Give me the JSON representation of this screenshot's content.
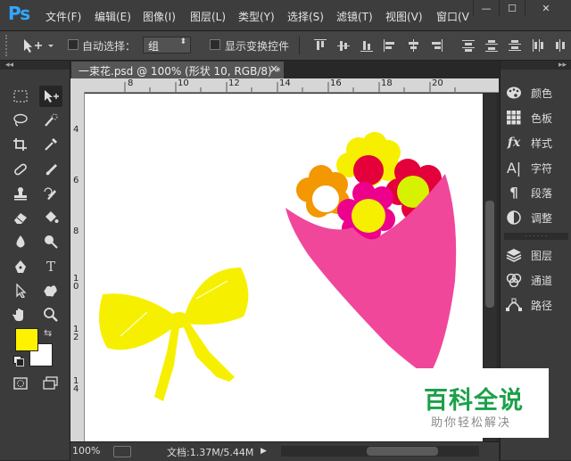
{
  "app": {
    "logo": "Ps"
  },
  "menu": [
    "文件(F)",
    "编辑(E)",
    "图像(I)",
    "图层(L)",
    "类型(Y)",
    "选择(S)",
    "滤镜(T)",
    "视图(V)",
    "窗口(V"
  ],
  "window_controls": {
    "minimize": "—",
    "maximize": "☐",
    "close": "✕"
  },
  "options": {
    "auto_select_label": "自动选择：",
    "auto_select_value": "组",
    "show_transform_label": "显示变换控件"
  },
  "document": {
    "tab_title": "一束花.psd @ 100% (形状 10, RGB/8) *",
    "close_glyph": "×"
  },
  "ruler": {
    "h_ticks": [
      "8",
      "10",
      "12",
      "14",
      "16",
      "18",
      "20"
    ],
    "v_ticks": [
      "4",
      "6",
      "8",
      "1 0",
      "1 2",
      "1 4"
    ]
  },
  "status": {
    "zoom": "100%",
    "doc_info": "文档:1.37M/5.44M"
  },
  "colors": {
    "foreground": "#fff200",
    "background": "#ffffff",
    "bouquet": "#f0479b",
    "bow": "#f6f000"
  },
  "panels": {
    "group1": [
      {
        "icon": "palette-icon",
        "label": "颜色"
      },
      {
        "icon": "swatches-icon",
        "label": "色板"
      },
      {
        "icon": "styles-icon",
        "label": "样式"
      },
      {
        "icon": "character-icon",
        "label": "字符"
      },
      {
        "icon": "paragraph-icon",
        "label": "段落"
      },
      {
        "icon": "adjustments-icon",
        "label": "调整"
      }
    ],
    "group2": [
      {
        "icon": "layers-icon",
        "label": "图层"
      },
      {
        "icon": "channels-icon",
        "label": "通道"
      },
      {
        "icon": "paths-icon",
        "label": "路径"
      }
    ]
  },
  "watermark": {
    "title": "百科全说",
    "subtitle": "助你轻松解决"
  }
}
